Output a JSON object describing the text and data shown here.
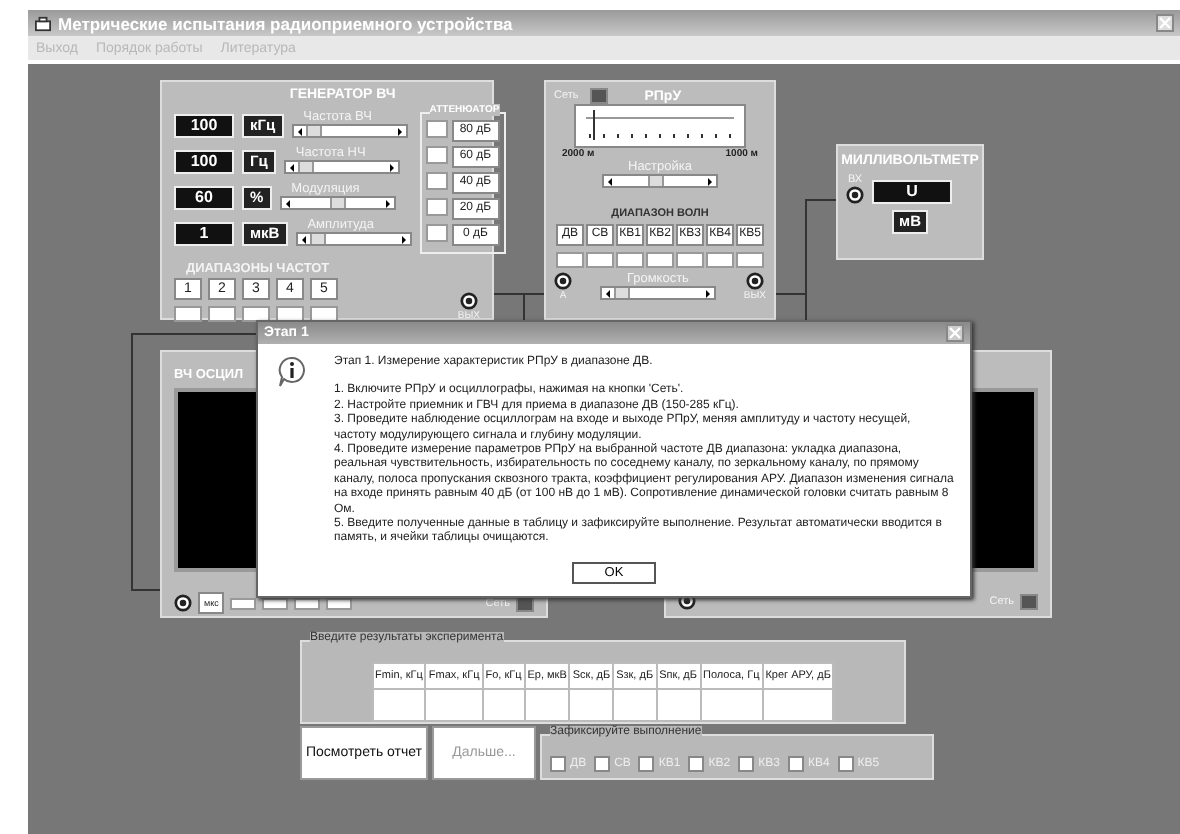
{
  "window": {
    "title": "Метрические испытания радиоприемного устройства"
  },
  "menu": [
    {
      "label": "Выход"
    },
    {
      "label": "Порядок работы"
    },
    {
      "label": "Литература"
    }
  ],
  "generator": {
    "title": "ГЕНЕРАТОР ВЧ",
    "rows": [
      {
        "value": "100",
        "unit": "кГц",
        "label": "Частота ВЧ"
      },
      {
        "value": "100",
        "unit": "Гц",
        "label": "Частота НЧ"
      },
      {
        "value": "60",
        "unit": "%",
        "label": "Модуляция"
      },
      {
        "value": "1",
        "unit": "мкВ",
        "label": "Амплитуда"
      }
    ],
    "attenuator": {
      "title": "АТТЕНЮАТОР",
      "steps": [
        "80 дБ",
        "60 дБ",
        "40 дБ",
        "20 дБ",
        "0 дБ"
      ]
    },
    "ranges_title": "ДИАПАЗОНЫ ЧАСТОТ",
    "ranges": [
      "1",
      "2",
      "3",
      "4",
      "5"
    ],
    "output": "ВЫХ"
  },
  "receiver": {
    "power_label": "Сеть",
    "power_on": false,
    "title": "РПрУ",
    "scale": {
      "left": "2000 м",
      "right": "1000 м"
    },
    "tuning": {
      "label": "Настройка"
    },
    "bands_title": "ДИАПАЗОН ВОЛН",
    "bands": [
      "ДВ",
      "СВ",
      "КВ1",
      "КВ2",
      "КВ3",
      "КВ4",
      "КВ5"
    ],
    "volume": {
      "label": "Громкость"
    },
    "input": "А",
    "output": "ВЫХ"
  },
  "millivoltmeter": {
    "title": "МИЛЛИВОЛЬТМЕТР",
    "input": "ВХ",
    "display": "U",
    "unit": "мВ"
  },
  "oscilloscopes": [
    {
      "title": "ВЧ ОСЦИЛ",
      "time_unit": "мкс",
      "power_label": "Сеть",
      "power_on": false
    },
    {
      "power_label": "Сеть",
      "power_on": false
    }
  ],
  "dialog": {
    "title": "Этап 1",
    "heading": "Этап 1. Измерение характеристик РПрУ в диапазоне ДВ.",
    "steps": [
      "1. Включите РПрУ и осциллографы,  нажимая на кнопки 'Сеть'.",
      "2. Настройте приемник и ГВЧ для приема в диапазоне ДВ (150-285 кГц).",
      "3. Проведите наблюдение осциллограм на входе и выходе РПрУ, меняя амплитуду и частоту несущей, частоту модулирующего сигнала и глубину модуляции.",
      "4. Проведите измерение параметров РПрУ на выбранной частоте ДВ диапазона: укладка диапазона, реальная чувствительность, избирательность по соседнему каналу, по зеркальному каналу, по прямому каналу, полоса пропускания сквозного тракта, коэффициент регулирования АРУ. Диапазон изменения сигнала на входе принять равным 40 дБ (от 100 нВ до 1 мВ). Сопротивление динамической головки считать равным 8 Ом.",
      "5. Введите полученные данные в таблицу и зафиксируйте выполнение. Результат автоматически вводится в память, и ячейки таблицы очищаются."
    ],
    "button": "OK"
  },
  "results": {
    "title": "Введите результаты эксперимента",
    "columns": [
      "Fmin, кГц",
      "Fmax, кГц",
      "Fo, кГц",
      "Ep, мкВ",
      "Sск, дБ",
      "Sзк, дБ",
      "Sпк, дБ",
      "Полоса, Гц",
      "Крег АРУ, дБ"
    ]
  },
  "buttons": [
    {
      "label": "Посмотреть отчет",
      "disabled": false
    },
    {
      "label": "Дальше...",
      "disabled": true
    }
  ],
  "completion": {
    "title": "Зафиксируйте выполнение",
    "items": [
      {
        "label": "ДВ",
        "checked": false
      },
      {
        "label": "СВ",
        "checked": false
      },
      {
        "label": "КВ1",
        "checked": false
      },
      {
        "label": "КВ2",
        "checked": false
      },
      {
        "label": "КВ3",
        "checked": false
      },
      {
        "label": "КВ4",
        "checked": false
      },
      {
        "label": "КВ5",
        "checked": false
      }
    ]
  }
}
